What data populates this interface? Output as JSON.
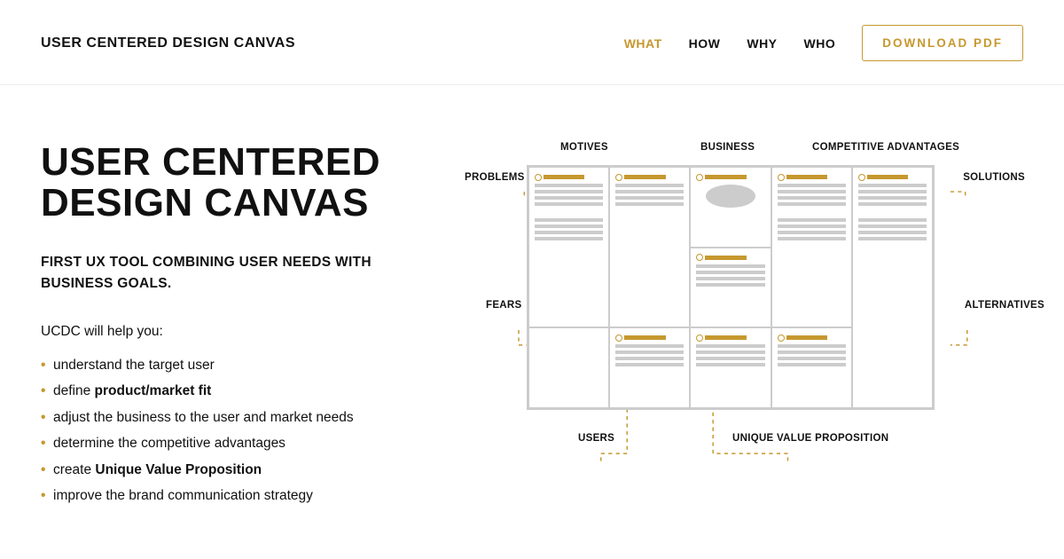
{
  "header": {
    "logo": "USER CENTERED DESIGN CANVAS",
    "nav": {
      "what": "WHAT",
      "how": "HOW",
      "why": "WHY",
      "who": "WHO"
    },
    "download": "DOWNLOAD  PDF"
  },
  "hero": {
    "title": "USER CENTERED DESIGN CANVAS",
    "subtitle": "FIRST UX TOOL COMBINING USER NEEDS WITH BUSINESS GOALS.",
    "helps_intro": "UCDC will help you:",
    "bullets": {
      "b1": "understand the target user",
      "b2_pre": "define ",
      "b2_strong": "product/market fit",
      "b3": "adjust the business to the user and market needs",
      "b4": "determine the competitive advantages",
      "b5_pre": "create ",
      "b5_strong": "Unique Value Proposition",
      "b6": "improve the brand communication strategy"
    }
  },
  "diagram": {
    "labels": {
      "problems": "PROBLEMS",
      "motives": "MOTIVES",
      "business": "BUSINESS",
      "comp_adv": "COMPETITIVE ADVANTAGES",
      "solutions": "SOLUTIONS",
      "fears": "FEARS",
      "alternatives": "ALTERNATIVES",
      "users": "USERS",
      "uvp": "UNIQUE VALUE PROPOSITION"
    }
  },
  "colors": {
    "accent": "#c6982f",
    "muted": "#ccc"
  }
}
